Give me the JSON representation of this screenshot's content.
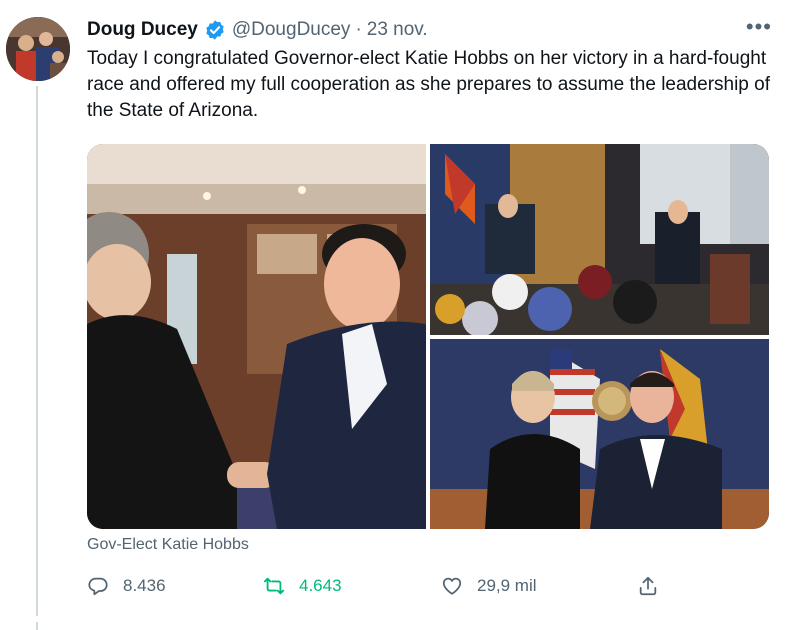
{
  "tweet": {
    "author_name": "Doug Ducey",
    "handle": "@DougDucey",
    "separator": "·",
    "timestamp": "23 nov.",
    "more_label": "•••",
    "text": "Today I congratulated Governor-elect Katie Hobbs on her victory in a hard-fought race and offered my full cooperation as she prepares to assume the leadership of the State of Arizona.",
    "media_caption": "Gov-Elect Katie Hobbs",
    "counts": {
      "replies": "8.436",
      "retweets": "4.643",
      "likes": "29,9 mil"
    }
  },
  "icons": {
    "verified": "verified-badge-icon",
    "more": "more-options-icon",
    "reply": "reply-icon",
    "retweet": "retweet-icon",
    "like": "heart-icon",
    "share": "share-icon"
  },
  "colors": {
    "accent": "#1d9bf0",
    "retweet_active": "#00ba7c",
    "secondary_text": "#536471",
    "primary_text": "#0f1419"
  }
}
